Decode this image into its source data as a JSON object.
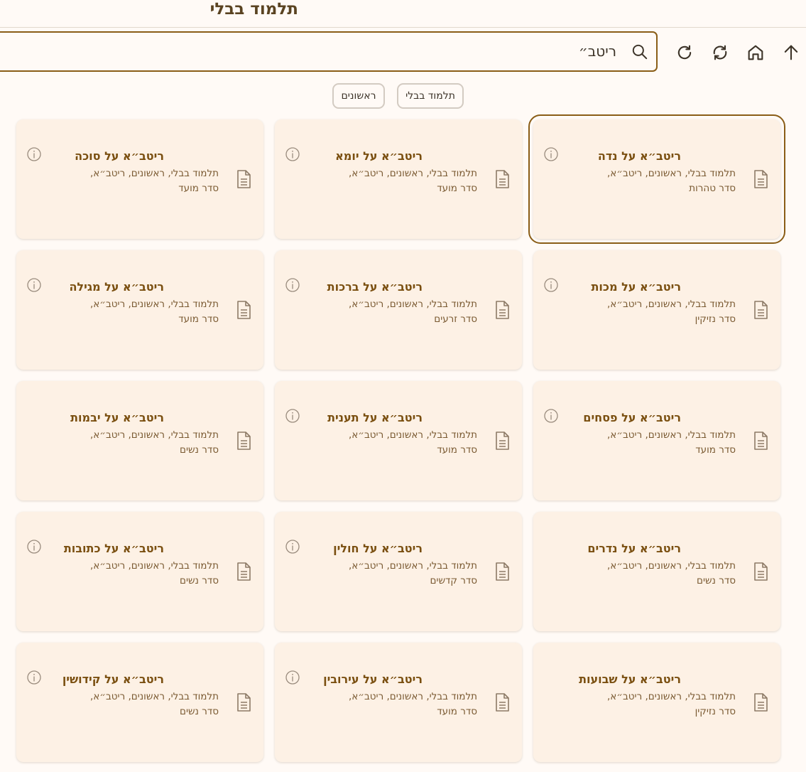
{
  "header": {
    "title": "תלמוד בבלי"
  },
  "search": {
    "value": "ריטב״"
  },
  "toolbar": {
    "icons": [
      "arrow-up-icon",
      "home-icon",
      "sync-icon",
      "refresh-icon",
      "search-icon"
    ]
  },
  "breadcrumbs": [
    {
      "label": "תלמוד בבלי"
    },
    {
      "label": "ראשונים"
    }
  ],
  "cards": [
    {
      "title": "ריטב״א על נדה",
      "line1": "תלמוד בבלי, ראשונים, ריטב״א,",
      "line2": "סדר טהרות",
      "info": true,
      "selected": true
    },
    {
      "title": "ריטב״א על יומא",
      "line1": "תלמוד בבלי, ראשונים, ריטב״א,",
      "line2": "סדר מועד",
      "info": true,
      "selected": false
    },
    {
      "title": "ריטב״א על סוכה",
      "line1": "תלמוד בבלי, ראשונים, ריטב״א,",
      "line2": "סדר מועד",
      "info": true,
      "selected": false
    },
    {
      "title": "ריטב״א על מכות",
      "line1": "תלמוד בבלי, ראשונים, ריטב״א,",
      "line2": "סדר נזיקין",
      "info": true,
      "selected": false
    },
    {
      "title": "ריטב״א על ברכות",
      "line1": "תלמוד בבלי, ראשונים, ריטב״א,",
      "line2": "סדר זרעים",
      "info": true,
      "selected": false
    },
    {
      "title": "ריטב״א על מגילה",
      "line1": "תלמוד בבלי, ראשונים, ריטב״א,",
      "line2": "סדר מועד",
      "info": true,
      "selected": false
    },
    {
      "title": "ריטב״א על פסחים",
      "line1": "תלמוד בבלי, ראשונים, ריטב״א,",
      "line2": "סדר מועד",
      "info": true,
      "selected": false
    },
    {
      "title": "ריטב״א על תענית",
      "line1": "תלמוד בבלי, ראשונים, ריטב״א,",
      "line2": "סדר מועד",
      "info": true,
      "selected": false
    },
    {
      "title": "ריטב״א על יבמות",
      "line1": "תלמוד בבלי, ראשונים, ריטב״א,",
      "line2": "סדר נשים",
      "info": false,
      "selected": false
    },
    {
      "title": "ריטב״א על נדרים",
      "line1": "תלמוד בבלי, ראשונים, ריטב״א,",
      "line2": "סדר נשים",
      "info": false,
      "selected": false
    },
    {
      "title": "ריטב״א על חולין",
      "line1": "תלמוד בבלי, ראשונים, ריטב״א,",
      "line2": "סדר קדשים",
      "info": true,
      "selected": false
    },
    {
      "title": "ריטב״א על כתובות",
      "line1": "תלמוד בבלי, ראשונים, ריטב״א,",
      "line2": "סדר נשים",
      "info": true,
      "selected": false
    },
    {
      "title": "ריטב״א על שבועות",
      "line1": "תלמוד בבלי, ראשונים, ריטב״א,",
      "line2": "סדר נזיקין",
      "info": false,
      "selected": false
    },
    {
      "title": "ריטב״א על עירובין",
      "line1": "תלמוד בבלי, ראשונים, ריטב״א,",
      "line2": "סדר מועד",
      "info": true,
      "selected": false
    },
    {
      "title": "ריטב״א על קידושין",
      "line1": "תלמוד בבלי, ראשונים, ריטב״א,",
      "line2": "סדר נשים",
      "info": true,
      "selected": false
    }
  ],
  "colors": {
    "accent": "#8a5d17",
    "title_text": "#7a4f10",
    "card_bg": "#fdf1e5",
    "page_bg": "#fffaf6"
  }
}
